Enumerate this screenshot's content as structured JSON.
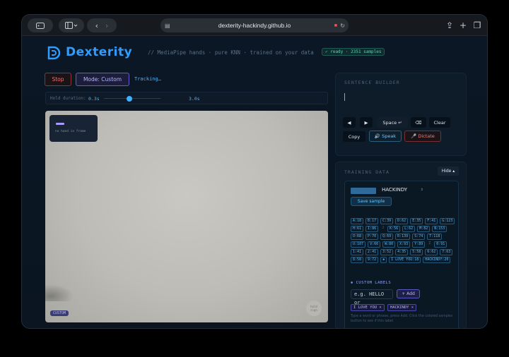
{
  "browser": {
    "url": "dexterity-hackindy.github.io"
  },
  "header": {
    "brand": "Dexterity",
    "tagline": "// MediaPipe hands · pure KNN · trained on your data",
    "badge": "✓ ready · 2351 samples"
  },
  "controls": {
    "stop_label": "Stop",
    "mode_label": "Mode: Custom",
    "status": "Tracking…",
    "hold_label": "Hold duration:",
    "hold_current": "0.3s",
    "hold_max": "3.0s",
    "hold_fraction": 0.34
  },
  "camera": {
    "overlay_message": "no hand in frame",
    "mode_tag": "CUSTOM",
    "hold_sign_line1": "hold",
    "hold_sign_line2": "sign"
  },
  "sentence_builder": {
    "title": "SENTENCE BUILDER",
    "text": "",
    "prev_label": "◀",
    "next_label": "▶",
    "space_label": "Space ↵",
    "backspace_label": "⌫",
    "clear_label": "Clear",
    "copy_label": "Copy",
    "speak_label": "🔊 Speak",
    "dictate_label": "🎤 Dictate"
  },
  "training": {
    "title": "TRAINING DATA",
    "hide_label": "Hide ▴",
    "label_prefix": "Label",
    "selected_label": "HACKINDY",
    "save_label": "Save sample",
    "samples": [
      {
        "text": "A:18",
        "kind": "chip"
      },
      {
        "text": "B:17",
        "kind": "chip"
      },
      {
        "text": "C:39",
        "kind": "chip"
      },
      {
        "text": "D:62",
        "kind": "chip"
      },
      {
        "text": "E:35",
        "kind": "chip"
      },
      {
        "text": "F:41",
        "kind": "chip"
      },
      {
        "text": "G:123",
        "kind": "chip"
      },
      {
        "text": "H:61",
        "kind": "chip"
      },
      {
        "text": "I:86",
        "kind": "chip"
      },
      {
        "text": "J",
        "kind": "plain"
      },
      {
        "text": "K:56",
        "kind": "chip"
      },
      {
        "text": "L:62",
        "kind": "chip"
      },
      {
        "text": "M:82",
        "kind": "chip"
      },
      {
        "text": "N:153",
        "kind": "chip"
      },
      {
        "text": "O:68",
        "kind": "chip"
      },
      {
        "text": "P:70",
        "kind": "chip"
      },
      {
        "text": "Q:69",
        "kind": "chip"
      },
      {
        "text": "R:139",
        "kind": "chip"
      },
      {
        "text": "S:74",
        "kind": "chip"
      },
      {
        "text": "T:118",
        "kind": "chip"
      },
      {
        "text": "U:107",
        "kind": "chip"
      },
      {
        "text": "V:66",
        "kind": "chip"
      },
      {
        "text": "W:80",
        "kind": "chip"
      },
      {
        "text": "X:93",
        "kind": "chip"
      },
      {
        "text": "Y:89",
        "kind": "chip"
      },
      {
        "text": "Z",
        "kind": "plain"
      },
      {
        "text": "0:91",
        "kind": "chip"
      },
      {
        "text": "1:41",
        "kind": "chip"
      },
      {
        "text": "2:41",
        "kind": "chip"
      },
      {
        "text": "3:52",
        "kind": "chip"
      },
      {
        "text": "4:35",
        "kind": "chip"
      },
      {
        "text": "5:58",
        "kind": "chip"
      },
      {
        "text": "6:62",
        "kind": "chip"
      },
      {
        "text": "7:63",
        "kind": "chip"
      },
      {
        "text": "8:58",
        "kind": "chip"
      },
      {
        "text": "9:72",
        "kind": "chip"
      },
      {
        "text": "✱",
        "kind": "chip"
      },
      {
        "text": "I LOVE YOU:18",
        "kind": "chip"
      },
      {
        "text": "HACKINDY:20",
        "kind": "chip"
      }
    ],
    "custom_title": "✱ CUSTOM LABELS",
    "custom_placeholder": "e.g. HELLO or",
    "add_label": "+ Add",
    "custom_labels": [
      "I LOVE YOU ×",
      "HACKINDY ×"
    ],
    "hint": "Type a word or phrase, press Add. Click the colored samples button to see if this label"
  },
  "colors": {
    "accent": "#2f9cff",
    "stop": "#ff6b6b",
    "mode": "#b7b6ff",
    "ready": "#5fd3b9"
  }
}
